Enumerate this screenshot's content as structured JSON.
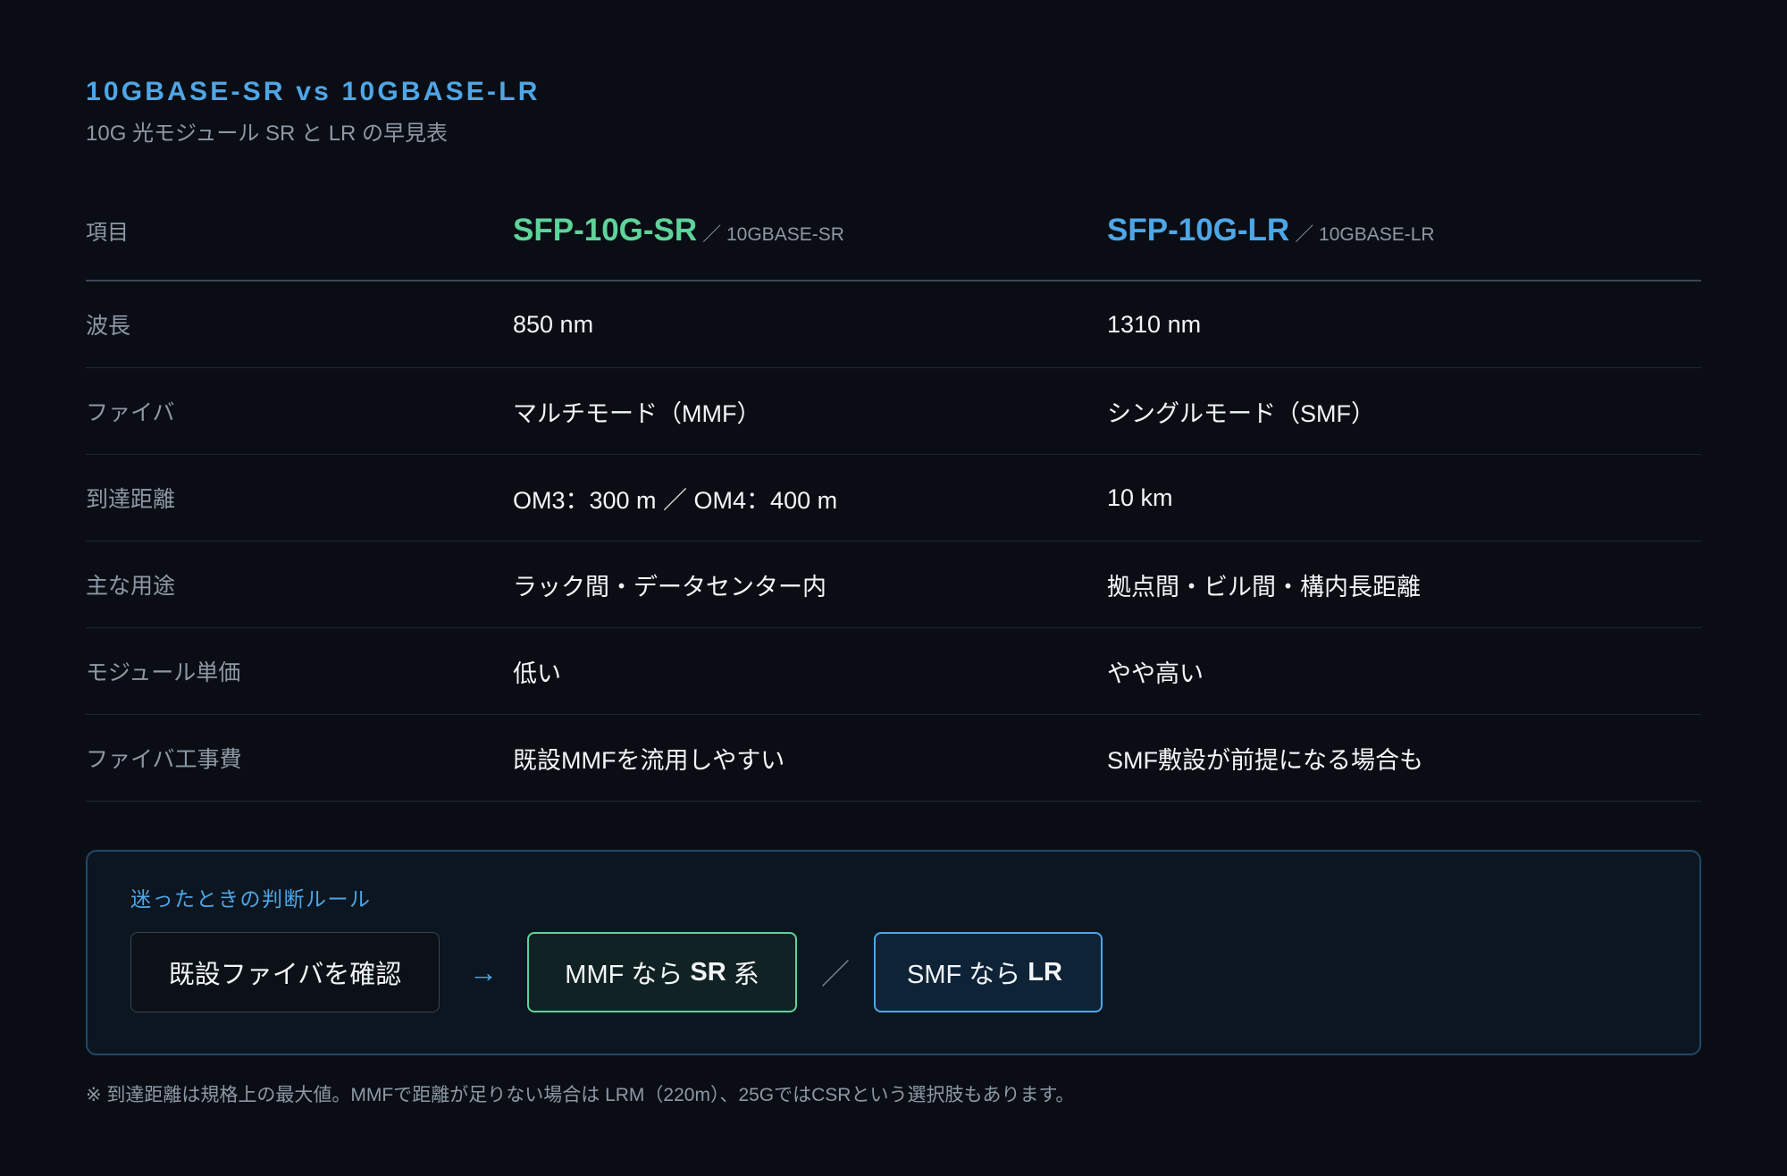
{
  "header": {
    "title": "10GBASE-SR vs 10GBASE-LR",
    "subtitle": "10G 光モジュール SR と LR の早見表"
  },
  "table": {
    "head": {
      "label": "項目",
      "sr_product": "SFP-10G-SR",
      "sr_standard": "／ 10GBASE-SR",
      "lr_product": "SFP-10G-LR",
      "lr_standard": "／ 10GBASE-LR"
    },
    "rows": [
      {
        "label": "波長",
        "sr": "850 nm",
        "lr": "1310 nm"
      },
      {
        "label": "ファイバ",
        "sr": "マルチモード（MMF）",
        "lr": "シングルモード（SMF）"
      },
      {
        "label": "到達距離",
        "sr": "OM3：300 m ／ OM4：400 m",
        "lr": "10 km"
      },
      {
        "label": "主な用途",
        "sr": "ラック間・データセンター内",
        "lr": "拠点間・ビル間・構内長距離"
      },
      {
        "label": "モジュール単価",
        "sr": "低い",
        "lr": "やや高い"
      },
      {
        "label": "ファイバ工事費",
        "sr": "既設MMFを流用しやすい",
        "lr": "SMF敷設が前提になる場合も"
      }
    ]
  },
  "rule": {
    "title": "迷ったときの判断ルール",
    "check": "既設ファイバを確認",
    "arrow": "→",
    "sr_prefix": "MMF なら",
    "sr_strong": "SR",
    "sr_suffix": "系",
    "separator": "／",
    "lr_prefix": "SMF なら",
    "lr_strong": "LR"
  },
  "note": "※ 到達距離は規格上の最大値。MMFで距離が足りない場合は LRM（220m）、25GではCSRという選択肢もあります。",
  "colors": {
    "background": "#0a0e14",
    "accent_blue": "#4fa6e6",
    "accent_green": "#5fd39a",
    "muted_text": "#8d98a6"
  }
}
